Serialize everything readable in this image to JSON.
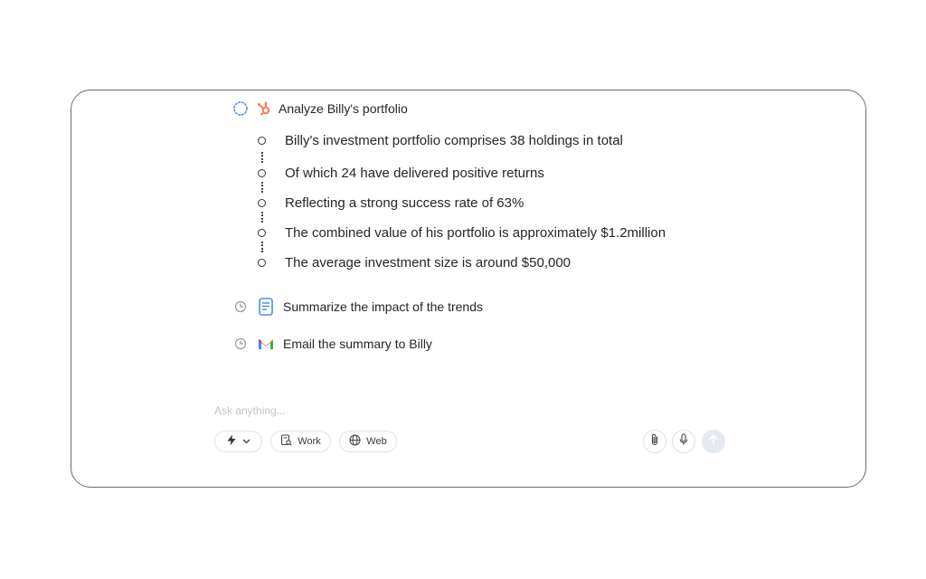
{
  "tasks": {
    "analyze": {
      "label": "Analyze Billy's portfolio",
      "status_icon": "loading-spinner-icon",
      "app_icon": "hubspot-icon",
      "steps": [
        "Billy's investment portfolio comprises 38 holdings in total",
        "Of which 24 have delivered positive returns",
        "Reflecting a strong success rate of 63%",
        "The combined value of his portfolio is approximately $1.2million",
        "The average investment size is around $50,000"
      ]
    },
    "summarize": {
      "label": "Summarize the impact of the trends",
      "status_icon": "clock-icon",
      "app_icon": "document-icon"
    },
    "email": {
      "label": "Email the summary to Billy",
      "status_icon": "clock-icon",
      "app_icon": "gmail-icon"
    }
  },
  "composer": {
    "placeholder": "Ask anything...",
    "mode_icon": "lightning-icon",
    "work_label": "Work",
    "web_label": "Web",
    "attach_icon": "paperclip-icon",
    "mic_icon": "microphone-icon",
    "send_icon": "arrow-up-icon"
  },
  "colors": {
    "hubspot": "#ff7a59",
    "doc_blue": "#4a90e2",
    "spinner_blue": "#5b8def",
    "send_bg": "#e4e9f2",
    "border": "#6b6b6b"
  }
}
